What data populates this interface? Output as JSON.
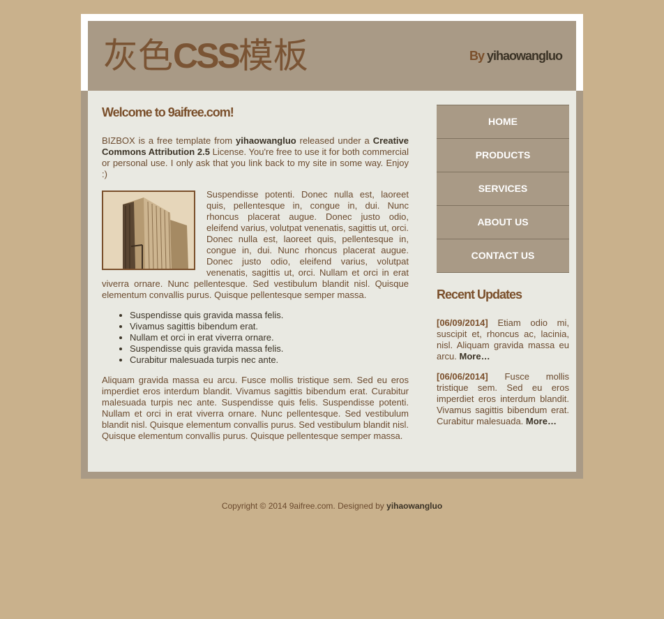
{
  "header": {
    "title_cjk_1": "灰色",
    "title_css": "CSS",
    "title_cjk_2": "模板",
    "by": "By",
    "author": "yihaowangluo"
  },
  "main": {
    "heading": "Welcome to 9aifree.com!",
    "intro": {
      "brand": "BIZBOX",
      "t1": " is a free template from ",
      "author": "yihaowangluo",
      "t2": " released under a ",
      "license": "Creative Commons Attribution 2.5",
      "t3": " License. You're free to use it for both commercial or personal use. I only ask that you link back to my site in some way. Enjoy :)"
    },
    "para2": "Suspendisse potenti. Donec nulla est, laoreet quis, pellentesque in, congue in, dui. Nunc rhoncus placerat augue. Donec justo odio, eleifend varius, volutpat venenatis, sagittis ut, orci. Donec nulla est, laoreet quis, pellentesque in, congue in, dui. Nunc rhoncus placerat augue. Donec justo odio, eleifend varius, volutpat venenatis, sagittis ut, orci. Nullam et orci in erat viverra ornare. Nunc pellentesque. Sed vestibulum blandit nisl. Quisque elementum convallis purus. Quisque pellentesque semper massa.",
    "list": [
      "Suspendisse quis gravida massa felis.",
      "Vivamus sagittis bibendum erat.",
      "Nullam et orci in erat viverra ornare.",
      "Suspendisse quis gravida massa felis.",
      "Curabitur malesuada turpis nec ante."
    ],
    "para3": "Aliquam gravida massa eu arcu. Fusce mollis tristique sem. Sed eu eros imperdiet eros interdum blandit. Vivamus sagittis bibendum erat. Curabitur malesuada turpis nec ante. Suspendisse quis felis. Suspendisse potenti. Nullam et orci in erat viverra ornare. Nunc pellentesque. Sed vestibulum blandit nisl. Quisque elementum convallis purus. Sed vestibulum blandit nisl. Quisque elementum convallis purus. Quisque pellentesque semper massa."
  },
  "nav": [
    "HOME",
    "PRODUCTS",
    "SERVICES",
    "ABOUT US",
    "CONTACT US"
  ],
  "updates": {
    "title": "Recent Updates",
    "items": [
      {
        "date": "[06/09/2014]",
        "text": " Etiam odio mi, suscipit et, rhoncus ac, lacinia, nisl. Aliquam gravida massa eu arcu. ",
        "more": "More…"
      },
      {
        "date": "[06/06/2014]",
        "text": " Fusce mollis tristique sem. Sed eu eros imperdiet eros interdum blandit. Vivamus sagittis bibendum erat. Curabitur malesuada. ",
        "more": "More…"
      }
    ]
  },
  "footer": {
    "text": "Copyright © 2014 9aifree.com. Designed by ",
    "author": "yihaowangluo"
  },
  "colors": {
    "page_bg": "#c9b18c",
    "frame": "#a99a86",
    "content_bg": "#e9e9e2",
    "brown_text": "#7a4f2b",
    "dark_text": "#3b3326"
  }
}
